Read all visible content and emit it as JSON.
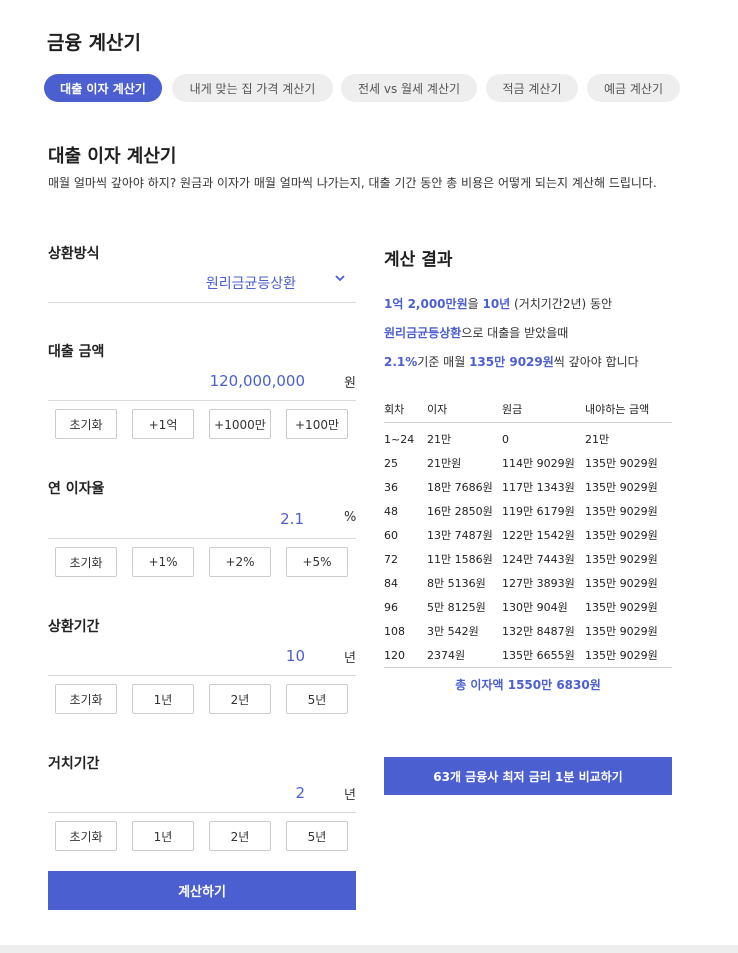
{
  "app": {
    "title": "금융 계산기"
  },
  "tabs": [
    {
      "label": "대출 이자 계산기",
      "active": true
    },
    {
      "label": "내게 맞는 집 가격 계산기",
      "active": false
    },
    {
      "label": "전세 vs 월세 계산기",
      "active": false
    },
    {
      "label": "적금 계산기",
      "active": false
    },
    {
      "label": "예금 계산기",
      "active": false
    }
  ],
  "section": {
    "title": "대출 이자 계산기",
    "description": "매월 얼마씩 갚아야 하지?  원금과 이자가 매월 얼마씩 나가는지, 대출 기간 동안 총 비용은 어떻게 되는지 계산해 드립니다."
  },
  "form": {
    "repayment_method": {
      "label": "상환방식",
      "value": "원리금균등상환",
      "icon": "chevron-down-icon"
    },
    "loan_amount": {
      "label": "대출 금액",
      "value": "120,000,000",
      "unit": "원",
      "buttons": [
        "초기화",
        "+1억",
        "+1000만",
        "+100만"
      ]
    },
    "interest_rate": {
      "label": "연 이자율",
      "value": "2.1",
      "unit": "%",
      "buttons": [
        "초기화",
        "+1%",
        "+2%",
        "+5%"
      ]
    },
    "term": {
      "label": "상환기간",
      "value": "10",
      "unit": "년",
      "buttons": [
        "초기화",
        "1년",
        "2년",
        "5년"
      ]
    },
    "grace": {
      "label": "거치기간",
      "value": "2",
      "unit": "년",
      "buttons": [
        "초기화",
        "1년",
        "2년",
        "5년"
      ]
    },
    "submit_label": "계산하기"
  },
  "result": {
    "title": "계산 결과",
    "line1": {
      "amount": "1억 2,000만원",
      "t1": "을 ",
      "term": "10년",
      "t2": " (거치기간2년) 동안"
    },
    "line2": {
      "method": "원리금균등상환",
      "t1": "으로 대출을 받았을때"
    },
    "line3": {
      "rate": "2.1%",
      "t1": "기준 매월 ",
      "monthly": "135만 9029원",
      "t2": "씩 갚아야 합니다"
    },
    "table": {
      "headers": [
        "회차",
        "이자",
        "원금",
        "내야하는 금액"
      ],
      "rows": [
        [
          "1~24",
          "21만",
          "0",
          "21만"
        ],
        [
          "25",
          "21만원",
          "114만 9029원",
          "135만 9029원"
        ],
        [
          "36",
          "18만 7686원",
          "117만 1343원",
          "135만 9029원"
        ],
        [
          "48",
          "16만 2850원",
          "119만 6179원",
          "135만 9029원"
        ],
        [
          "60",
          "13만 7487원",
          "122만 1542원",
          "135만 9029원"
        ],
        [
          "72",
          "11만 1586원",
          "124만 7443원",
          "135만 9029원"
        ],
        [
          "84",
          "8만 5136원",
          "127만 3893원",
          "135만 9029원"
        ],
        [
          "96",
          "5만 8125원",
          "130만 904원",
          "135만 9029원"
        ],
        [
          "108",
          "3만 542원",
          "132만 8487원",
          "135만 9029원"
        ],
        [
          "120",
          "2374원",
          "135만 6655원",
          "135만 9029원"
        ]
      ]
    },
    "total": "총 이자액 1550만 6830원",
    "compare_label": "63개 금융사 최저 금리 1분 비교하기"
  },
  "colors": {
    "accent": "#4b5fd1",
    "tab_bg": "#eeeeee",
    "divider": "#d9d9d9"
  }
}
